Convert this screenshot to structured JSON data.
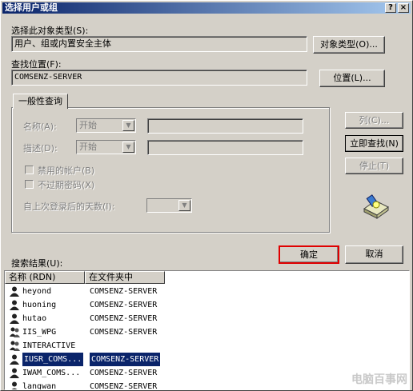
{
  "window": {
    "title": "选择用户或组",
    "help_btn": "?",
    "close_btn": "×"
  },
  "object_type": {
    "label": "选择此对象类型(S):",
    "value": "用户、组或内置安全主体",
    "button": "对象类型(O)..."
  },
  "location": {
    "label": "查找位置(F):",
    "value": "COMSENZ-SERVER",
    "button": "位置(L)..."
  },
  "tab": {
    "label": "一般性查询"
  },
  "query": {
    "name_label": "名称(A):",
    "name_mode": "开始",
    "desc_label": "描述(D):",
    "desc_mode": "开始",
    "disabled_accounts": "禁用的帐户(B)",
    "no_expire_pwd": "不过期密码(X)",
    "days_label": "自上次登录后的天数(I):"
  },
  "side_buttons": {
    "columns": "列(C)...",
    "find_now": "立即查找(N)",
    "stop": "停止(T)"
  },
  "dialog_buttons": {
    "ok": "确定",
    "cancel": "取消"
  },
  "results": {
    "label": "搜索结果(U):",
    "columns": [
      "名称 (RDN)",
      "在文件夹中"
    ],
    "rows": [
      {
        "name": "heyond",
        "folder": "COMSENZ-SERVER",
        "icon": "user-icon"
      },
      {
        "name": "huoning",
        "folder": "COMSENZ-SERVER",
        "icon": "user-icon"
      },
      {
        "name": "hutao",
        "folder": "COMSENZ-SERVER",
        "icon": "user-icon"
      },
      {
        "name": "IIS_WPG",
        "folder": "COMSENZ-SERVER",
        "icon": "group-icon"
      },
      {
        "name": "INTERACTIVE",
        "folder": "",
        "icon": "group-icon"
      },
      {
        "name": "IUSR_COMS...",
        "folder": "COMSENZ-SERVER",
        "icon": "user-icon",
        "selected": true
      },
      {
        "name": "IWAM_COMS...",
        "folder": "COMSENZ-SERVER",
        "icon": "user-icon"
      },
      {
        "name": "langwan",
        "folder": "COMSENZ-SERVER",
        "icon": "user-icon"
      }
    ]
  },
  "watermark": "电脑百事网",
  "colors": {
    "selection": "#0a246a",
    "highlight_border": "#e00000",
    "face": "#d4d0c8"
  }
}
